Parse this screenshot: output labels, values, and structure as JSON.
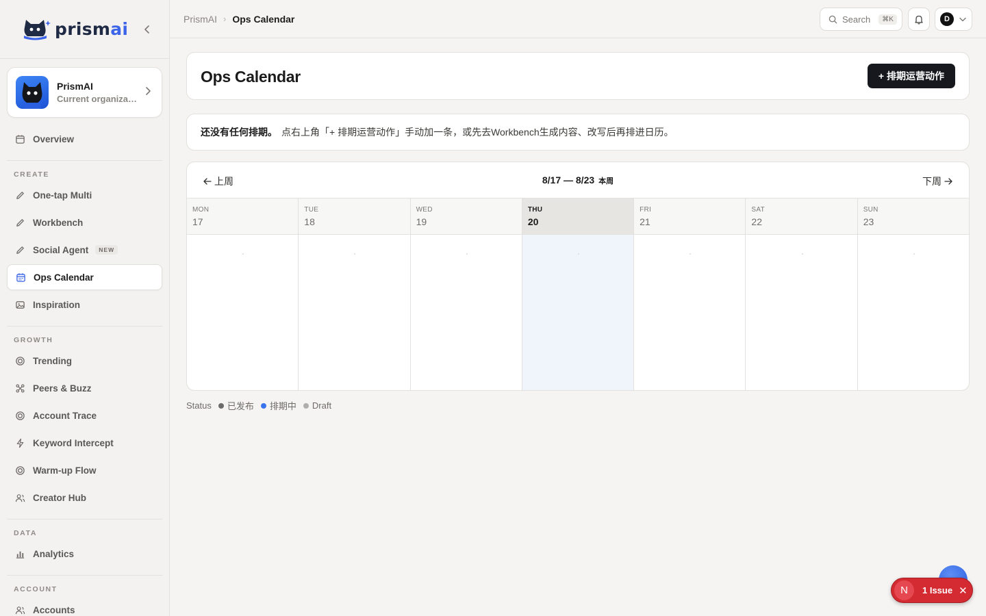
{
  "app": {
    "logo_text_main": "prism",
    "logo_text_accent": "ai"
  },
  "org": {
    "name": "PrismAI",
    "subtitle": "Current organization"
  },
  "sidebar": {
    "overview": "Overview",
    "sections": {
      "create": "CREATE",
      "growth": "GROWTH",
      "data": "DATA",
      "account": "ACCOUNT"
    },
    "create_items": [
      "One-tap Multi",
      "Workbench",
      "Social Agent",
      "Ops Calendar",
      "Inspiration"
    ],
    "new_badge": "NEW",
    "growth_items": [
      "Trending",
      "Peers & Buzz",
      "Account Trace",
      "Keyword Intercept",
      "Warm-up Flow",
      "Creator Hub"
    ],
    "data_items": [
      "Analytics"
    ],
    "account_items": [
      "Accounts"
    ]
  },
  "topbar": {
    "crumb_root": "PrismAI",
    "crumb_sep": "›",
    "crumb_current": "Ops Calendar",
    "search_label": "Search",
    "search_kbd": "⌘K",
    "user_initial": "D"
  },
  "page": {
    "title": "Ops Calendar",
    "add_button": "+ 排期运营动作"
  },
  "notice": {
    "strong": "还没有任何排期。",
    "text": "点右上角「+ 排期运营动作」手动加一条，或先去Workbench生成内容、改写后再排进日历。"
  },
  "calendar": {
    "prev_label": "上周",
    "next_label": "下周",
    "range": "8/17 — 8/23",
    "this_week": "本周",
    "days": [
      {
        "dow": "MON",
        "num": "17"
      },
      {
        "dow": "TUE",
        "num": "18"
      },
      {
        "dow": "WED",
        "num": "19"
      },
      {
        "dow": "THU",
        "num": "20"
      },
      {
        "dow": "FRI",
        "num": "21"
      },
      {
        "dow": "SAT",
        "num": "22"
      },
      {
        "dow": "SUN",
        "num": "23"
      }
    ],
    "today_index": 3
  },
  "legend": {
    "label": "Status",
    "items": [
      {
        "label": "已发布",
        "color": "#6b6b6b"
      },
      {
        "label": "排期中",
        "color": "#3b74f0"
      },
      {
        "label": "Draft",
        "color": "#b0aeaa"
      }
    ]
  },
  "issue": {
    "letter": "N",
    "label": "1 Issue",
    "close": "✕"
  },
  "colors": {
    "accent": "#3b64e8",
    "primary_button": "#16181d",
    "today_column": "#f0f5fc",
    "issue_red": "#d42a31"
  }
}
